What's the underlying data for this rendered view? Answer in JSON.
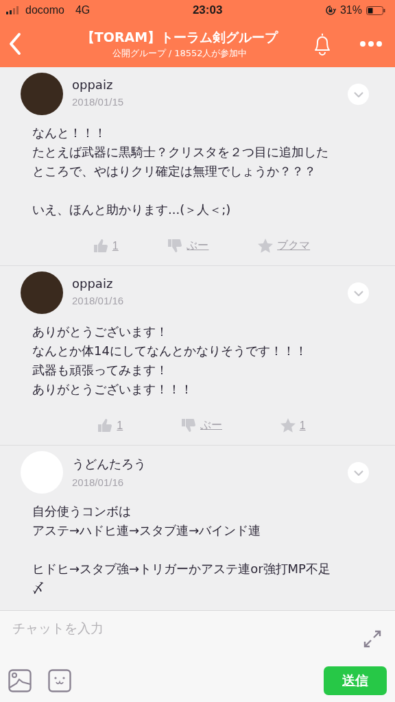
{
  "status_bar": {
    "carrier": "docomo",
    "network": "4G",
    "time": "23:03",
    "battery": "31%"
  },
  "header": {
    "title": "【TORAM】トーラム剣グループ",
    "subtitle": "公開グループ / 18552人が参加中"
  },
  "posts": [
    {
      "author": "oppaiz",
      "date": "2018/01/15",
      "paragraphs": [
        [
          "なんと！！！",
          "たとえば武器に黒騎士？クリスタを２つ目に追加した",
          "ところで、やはりクリ確定は無理でしょうか？？？"
        ],
        [
          "いえ、ほんと助かります...(＞人＜;)"
        ]
      ],
      "reactions": [
        {
          "kind": "like",
          "label": "1"
        },
        {
          "kind": "dislike",
          "label": "ぶー"
        },
        {
          "kind": "bookmark",
          "label": "ブクマ"
        }
      ]
    },
    {
      "author": "oppaiz",
      "date": "2018/01/16",
      "paragraphs": [
        [
          "ありがとうございます！",
          "なんとか体14にしてなんとかなりそうです！！！",
          "武器も頑張ってみます！",
          "ありがとうございます！！！"
        ]
      ],
      "reactions": [
        {
          "kind": "like",
          "label": "1"
        },
        {
          "kind": "dislike",
          "label": "ぶー"
        },
        {
          "kind": "bookmark",
          "label": "1"
        }
      ]
    },
    {
      "author": "うどんたろう",
      "date": "2018/01/16",
      "paragraphs": [
        [
          "自分使うコンボは",
          "アステ→ハドヒ連→スタブ連→バインド連"
        ],
        [
          "ヒドヒ→スタブ強→トリガーかアステ連or強打MP不足",
          "〆"
        ]
      ]
    }
  ],
  "composer": {
    "placeholder": "チャットを入力",
    "send": "送信"
  }
}
